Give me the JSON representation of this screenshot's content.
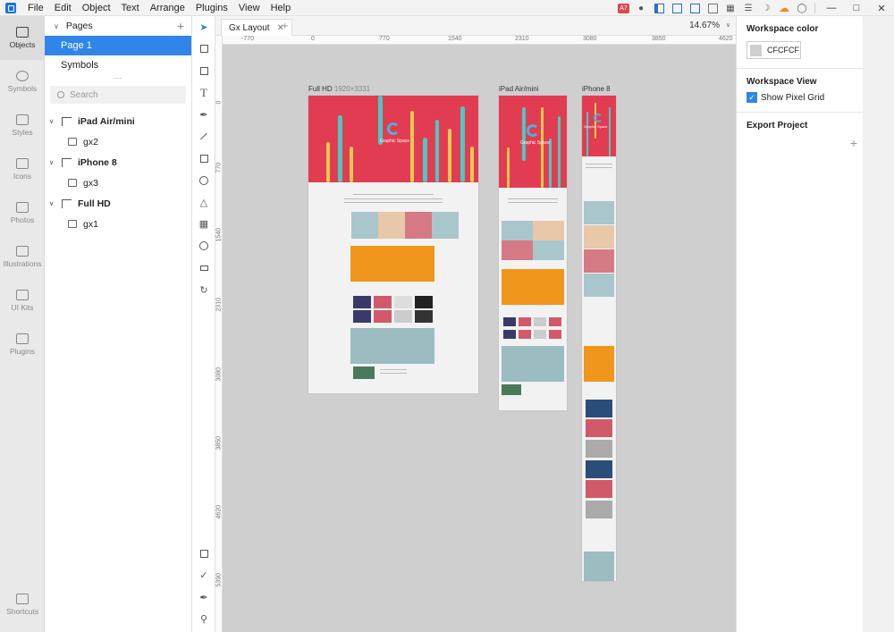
{
  "menubar": {
    "items": [
      "File",
      "Edit",
      "Object",
      "Text",
      "Arrange",
      "Plugins",
      "View",
      "Help"
    ],
    "badge_text": "A7"
  },
  "rail": {
    "items": [
      {
        "label": "Objects",
        "icon": "objects-icon",
        "active": true
      },
      {
        "label": "Symbols",
        "icon": "symbols-icon"
      },
      {
        "label": "Styles",
        "icon": "styles-icon"
      },
      {
        "label": "Icons",
        "icon": "icons-icon"
      },
      {
        "label": "Photos",
        "icon": "photos-icon"
      },
      {
        "label": "Illustrations",
        "icon": "illustrations-icon"
      },
      {
        "label": "UI Kits",
        "icon": "ui-kits-icon"
      },
      {
        "label": "Plugins",
        "icon": "plugins-icon"
      }
    ],
    "bottom": "Shortcuts"
  },
  "pages": {
    "title": "Pages",
    "list": [
      "Page 1",
      "Symbols"
    ],
    "selected": "Page 1",
    "search_placeholder": "Search",
    "tree": [
      {
        "artboard": "iPad Air/mini",
        "image": "gx2"
      },
      {
        "artboard": "iPhone 8",
        "image": "gx3"
      },
      {
        "artboard": "Full HD",
        "image": "gx1"
      }
    ]
  },
  "tab": {
    "name": "Gx Layout"
  },
  "zoom": "14.67%",
  "ruler": {
    "h": [
      "-770",
      "0",
      "770",
      "1540",
      "2310",
      "3080",
      "3850",
      "4620"
    ],
    "v": [
      "0",
      "770",
      "1540",
      "2310",
      "3080",
      "3850",
      "4620",
      "5390"
    ]
  },
  "artboards": {
    "full_hd": {
      "name": "Full HD",
      "size": "1920×3331",
      "logo_text": "Graphic Space"
    },
    "ipad": {
      "name": "iPad Air/mini",
      "logo_text": "Graphic Space"
    },
    "iphone": {
      "name": "iPhone 8",
      "logo_text": "Graphic Space"
    }
  },
  "props": {
    "workspace_color_title": "Workspace color",
    "workspace_color_value": "CFCFCF",
    "workspace_view_title": "Workspace View",
    "show_pixel_grid": "Show Pixel Grid",
    "export_title": "Export Project"
  },
  "colors": {
    "accent": "#2f86e8",
    "canvas": "#cfcfcf",
    "hero": "#e23c52"
  }
}
